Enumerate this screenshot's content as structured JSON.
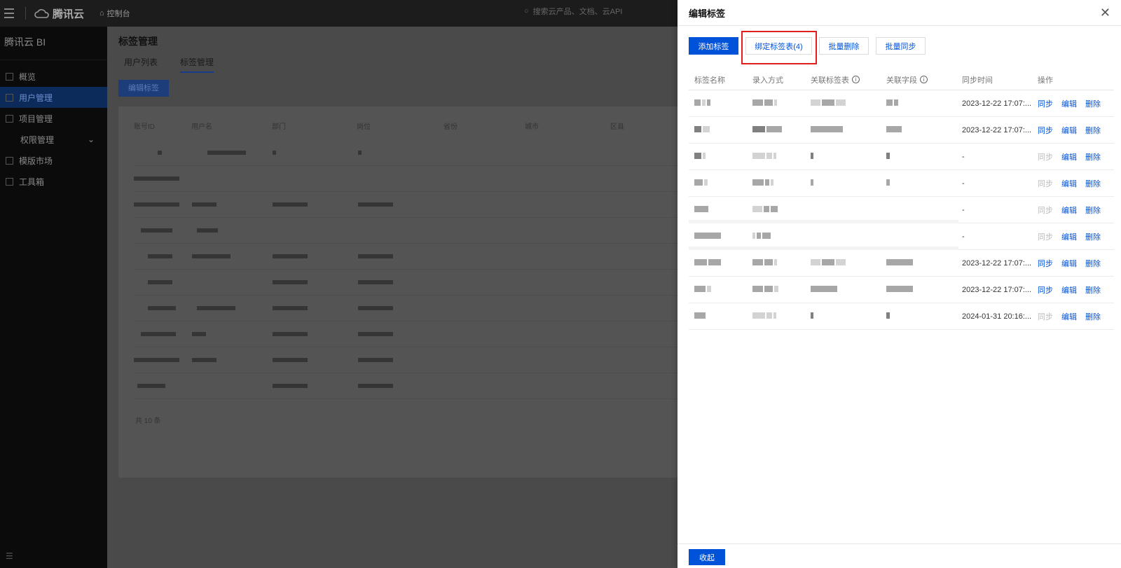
{
  "topbar": {
    "brand": "腾讯云",
    "console": "控制台",
    "search_placeholder": "搜索云产品、文档、云API"
  },
  "sidebar": {
    "app_title": "腾讯云 BI",
    "items": [
      {
        "label": "概览",
        "icon": "grid-icon"
      },
      {
        "label": "用户管理",
        "icon": "user-icon",
        "active": true
      },
      {
        "label": "项目管理",
        "icon": "folder-icon"
      },
      {
        "label": "权限管理",
        "icon": "lock-icon",
        "sub": true
      },
      {
        "label": "模版市场",
        "icon": "template-icon"
      },
      {
        "label": "工具箱",
        "icon": "toolbox-icon"
      }
    ]
  },
  "main": {
    "page_title": "标签管理",
    "tabs": [
      "用户列表",
      "标签管理"
    ],
    "edit_button": "编辑标签",
    "columns": [
      "账号ID",
      "用户名",
      "部门",
      "岗位",
      "省份",
      "城市",
      "区县"
    ],
    "total": "共 10 条"
  },
  "drawer": {
    "title": "编辑标签",
    "buttons": {
      "add": "添加标签",
      "bind": "绑定标签表(4)",
      "batch_delete": "批量删除",
      "batch_sync": "批量同步"
    },
    "columns": {
      "name": "标签名称",
      "entry": "录入方式",
      "linked_table": "关联标签表",
      "linked_field": "关联字段",
      "sync_time": "同步时间",
      "ops": "操作"
    },
    "ops": {
      "sync": "同步",
      "edit": "编辑",
      "delete": "删除"
    },
    "rows": [
      {
        "sync_time": "2023-12-22 17:07:...",
        "sync_enabled": true
      },
      {
        "sync_time": "2023-12-22 17:07:...",
        "sync_enabled": true
      },
      {
        "sync_time": "-",
        "sync_enabled": false
      },
      {
        "sync_time": "-",
        "sync_enabled": false
      },
      {
        "sync_time": "-",
        "sync_enabled": false
      },
      {
        "sync_time": "-",
        "sync_enabled": false
      },
      {
        "sync_time": "2023-12-22 17:07:...",
        "sync_enabled": true
      },
      {
        "sync_time": "2023-12-22 17:07:...",
        "sync_enabled": true
      },
      {
        "sync_time": "2024-01-31 20:16:...",
        "sync_enabled": false
      }
    ],
    "collapse": "收起"
  },
  "colors": {
    "primary": "#0052d9",
    "highlight": "#e01e1e"
  }
}
